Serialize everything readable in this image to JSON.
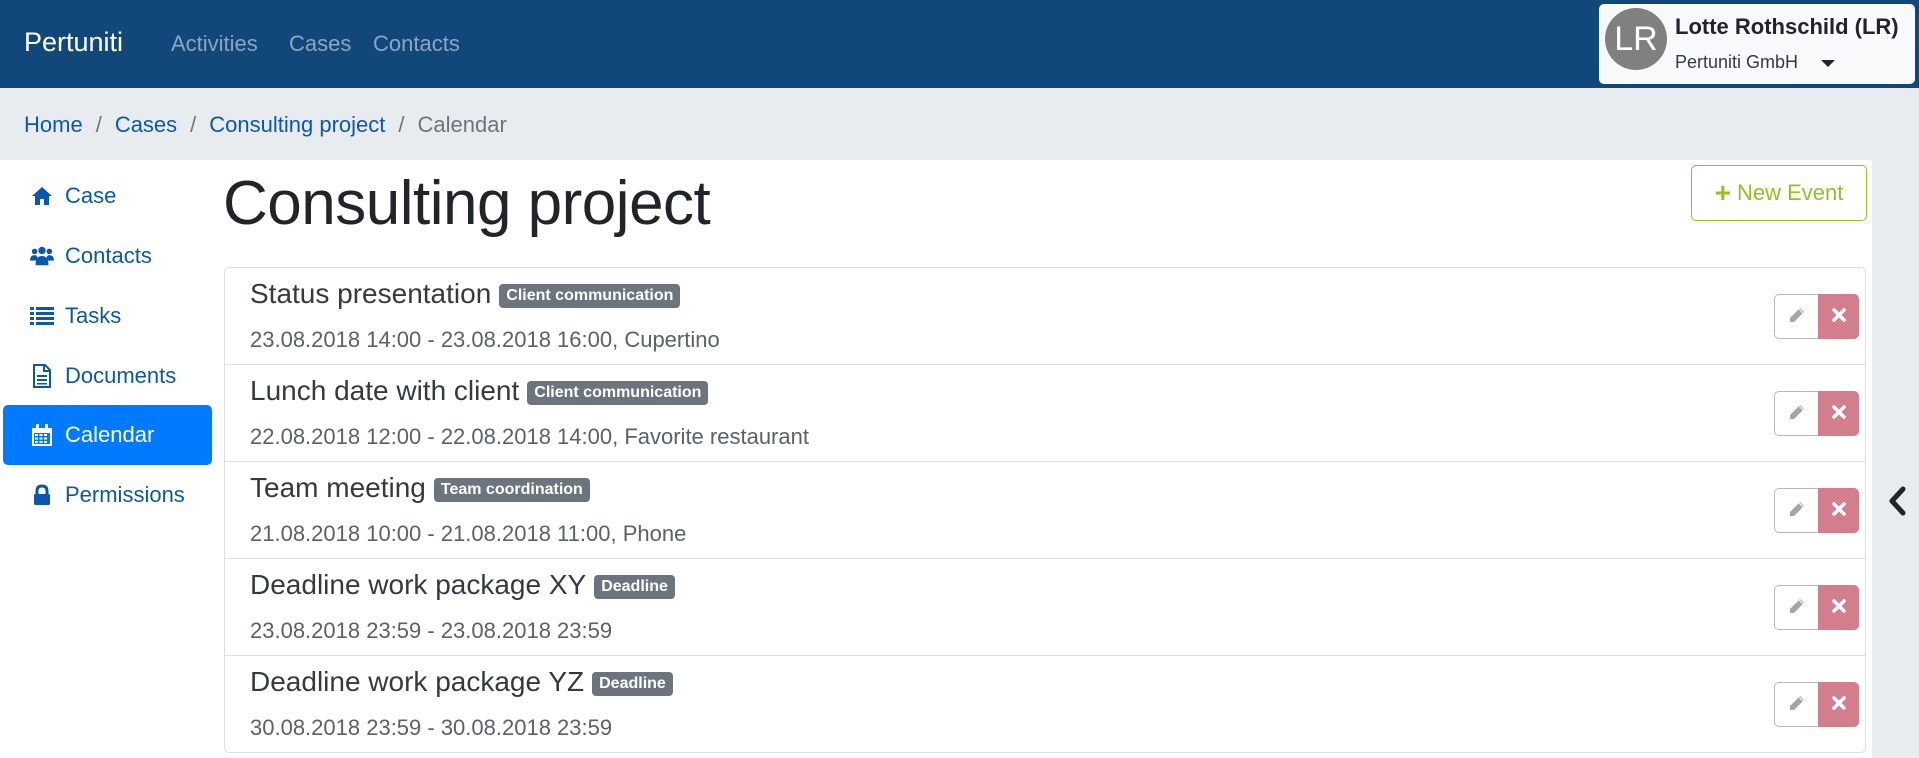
{
  "navbar": {
    "brand": "Pertuniti",
    "links": [
      {
        "label": "Activities"
      },
      {
        "label": "Cases"
      },
      {
        "label": "Contacts"
      }
    ],
    "user": {
      "initials": "LR",
      "name": "Lotte Rothschild (LR)",
      "organization": "Pertuniti GmbH"
    }
  },
  "breadcrumb": {
    "items": [
      {
        "label": "Home"
      },
      {
        "label": "Cases"
      },
      {
        "label": "Consulting project"
      }
    ],
    "active": "Calendar",
    "separator": "/"
  },
  "sidebar": {
    "items": [
      {
        "label": "Case",
        "icon": "home-icon"
      },
      {
        "label": "Contacts",
        "icon": "users-icon"
      },
      {
        "label": "Tasks",
        "icon": "list-icon"
      },
      {
        "label": "Documents",
        "icon": "document-icon"
      },
      {
        "label": "Calendar",
        "icon": "calendar-icon",
        "active": true
      },
      {
        "label": "Permissions",
        "icon": "lock-icon"
      }
    ]
  },
  "main": {
    "title": "Consulting project",
    "new_event_label": "New Event",
    "events": [
      {
        "title": "Status presentation",
        "category": "Client communication",
        "time": "23.08.2018 14:00 - 23.08.2018 16:00, Cupertino"
      },
      {
        "title": "Lunch date with client",
        "category": "Client communication",
        "time": "22.08.2018 12:00 - 22.08.2018 14:00, Favorite restaurant"
      },
      {
        "title": "Team meeting",
        "category": "Team coordination",
        "time": "21.08.2018 10:00 - 21.08.2018 11:00, Phone"
      },
      {
        "title": "Deadline work package XY",
        "category": "Deadline",
        "time": "23.08.2018 23:59 - 23.08.2018 23:59"
      },
      {
        "title": "Deadline work package YZ",
        "category": "Deadline",
        "time": "30.08.2018 23:59 - 30.08.2018 23:59"
      }
    ]
  },
  "colors": {
    "navbar": "#124779",
    "link": "#0b57b0",
    "active": "#007bff",
    "new_event": "#8fc31f",
    "delete": "#d37e8d",
    "badge": "#6c757d"
  }
}
